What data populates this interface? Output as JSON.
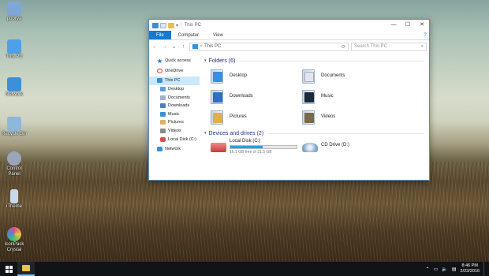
{
  "desktop": {
    "icons": [
      {
        "label": "poorya",
        "icon": "user-folder-icon",
        "color": "#7ea6d6"
      },
      {
        "label": "This PC",
        "icon": "computer-icon",
        "color": "#4ea0e8"
      },
      {
        "label": "Network",
        "icon": "network-icon",
        "color": "#3d8fd8"
      },
      {
        "label": "Recycle Bin",
        "icon": "recycle-bin-icon",
        "color": "#8fb6db"
      },
      {
        "label": "Control Panel",
        "icon": "control-panel-icon",
        "color": "#9aa5b8"
      },
      {
        "label": "iTheme",
        "icon": "theme-icon",
        "color": "#c7d9ee"
      },
      {
        "label": "IconPack Crystal",
        "icon": "crystal-icon",
        "color": "#d84d8f"
      }
    ]
  },
  "window": {
    "qat_label": "This PC",
    "title": "This PC",
    "controls": {
      "minimize": "—",
      "maximize": "☐",
      "close": "✕"
    },
    "tabs": [
      {
        "label": "File",
        "active": true
      },
      {
        "label": "Computer",
        "active": false
      },
      {
        "label": "View",
        "active": false
      }
    ],
    "help": "?",
    "address": {
      "path": "This PC",
      "separator": "›"
    },
    "search": {
      "placeholder": "Search This PC"
    },
    "nav": {
      "back": "←",
      "forward": "→",
      "recent": "⌄",
      "up": "↑"
    },
    "navpane": [
      {
        "label": "Quick access",
        "icon": "star-icon",
        "color": "#2f7ed8",
        "level": 0
      },
      {
        "label": "OneDrive",
        "icon": "onedrive-icon",
        "color": "#e0382b",
        "level": 0,
        "gap": true
      },
      {
        "label": "This PC",
        "icon": "computer-icon",
        "color": "#3a8fd6",
        "level": 0,
        "selected": true,
        "gap": true
      },
      {
        "label": "Desktop",
        "icon": "desktop-icon",
        "color": "#5aa0e0",
        "level": 1
      },
      {
        "label": "Documents",
        "icon": "documents-icon",
        "color": "#9fb2c6",
        "level": 1
      },
      {
        "label": "Downloads",
        "icon": "downloads-icon",
        "color": "#4f7fb8",
        "level": 1
      },
      {
        "label": "Music",
        "icon": "music-icon",
        "color": "#3a8fd6",
        "level": 1
      },
      {
        "label": "Pictures",
        "icon": "pictures-icon",
        "color": "#d8b36a",
        "level": 1
      },
      {
        "label": "Videos",
        "icon": "videos-icon",
        "color": "#8a8a8a",
        "level": 1
      },
      {
        "label": "Local Disk (C:)",
        "icon": "disk-icon",
        "color": "#d84d4d",
        "level": 1
      },
      {
        "label": "Network",
        "icon": "network-icon",
        "color": "#3a8fd6",
        "level": 0,
        "gap": true
      }
    ],
    "folders_header": "Folders (6)",
    "folders": [
      {
        "label": "Desktop",
        "icon": "desktop-folder-icon",
        "color": "#3b8fe0"
      },
      {
        "label": "Documents",
        "icon": "documents-folder-icon",
        "color": "#dfe6ee"
      },
      {
        "label": "Downloads",
        "icon": "downloads-folder-icon",
        "color": "#2f6fc2"
      },
      {
        "label": "Music",
        "icon": "music-folder-icon",
        "color": "#1b2a3a"
      },
      {
        "label": "Pictures",
        "icon": "pictures-folder-icon",
        "color": "#e0b04d"
      },
      {
        "label": "Videos",
        "icon": "videos-folder-icon",
        "color": "#7a6a4a"
      }
    ],
    "drives_header": "Devices and drives (2)",
    "drives": [
      {
        "label": "Local Disk (C:)",
        "free": "16.1 GB free of 31.5 GB",
        "used_fraction": 0.49,
        "icon": "local-disk-icon",
        "color": "#d84d4d"
      },
      {
        "label": "CD Drive (D:)",
        "icon": "cd-drive-icon",
        "color": "#7fa3c8"
      }
    ]
  },
  "taskbar": {
    "clock": {
      "time": "8:46 PM",
      "date": "2/23/2016"
    },
    "tray": {
      "chevron": "⌃",
      "network": "▭",
      "volume": "🔈",
      "notifications": "▤"
    }
  }
}
